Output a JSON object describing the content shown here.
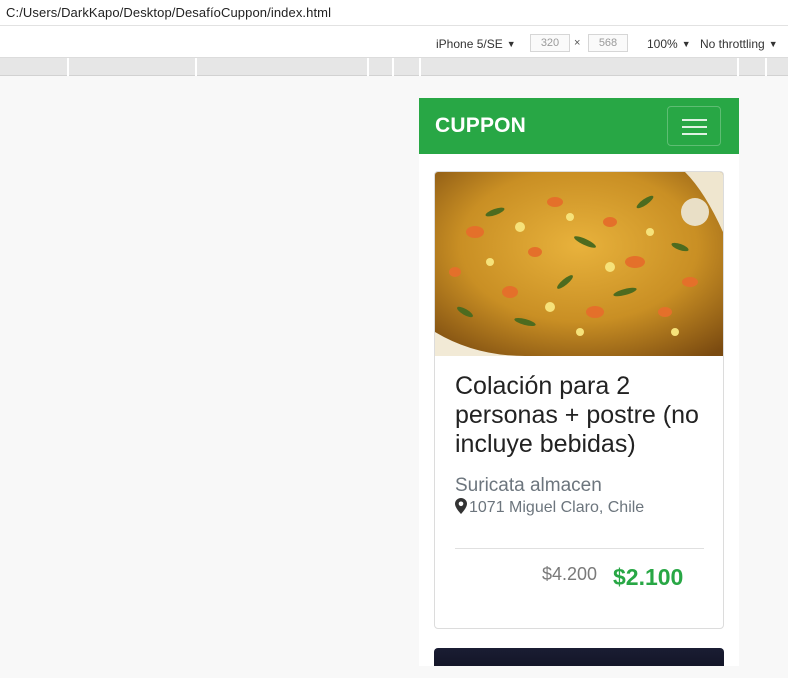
{
  "browser": {
    "url_path": "C:/Users/DarkKapo/Desktop/DesafíoCuppon/index.html"
  },
  "devtools": {
    "device": "iPhone 5/SE",
    "width": "320",
    "times": "×",
    "height": "568",
    "zoom": "100%",
    "throttle": "No throttling"
  },
  "navbar": {
    "brand": "CUPPON",
    "toggler_icon": "hamburger-icon",
    "color": "#28a745"
  },
  "card": {
    "image_icon": "food-photo",
    "title": "Colación para 2 personas + postre (no incluye bebidas)",
    "shop": "Suricata almacen",
    "address": "1071 Miguel Claro, Chile",
    "old_price": "$4.200",
    "new_price": "$2.100",
    "accent_color": "#28a745"
  }
}
